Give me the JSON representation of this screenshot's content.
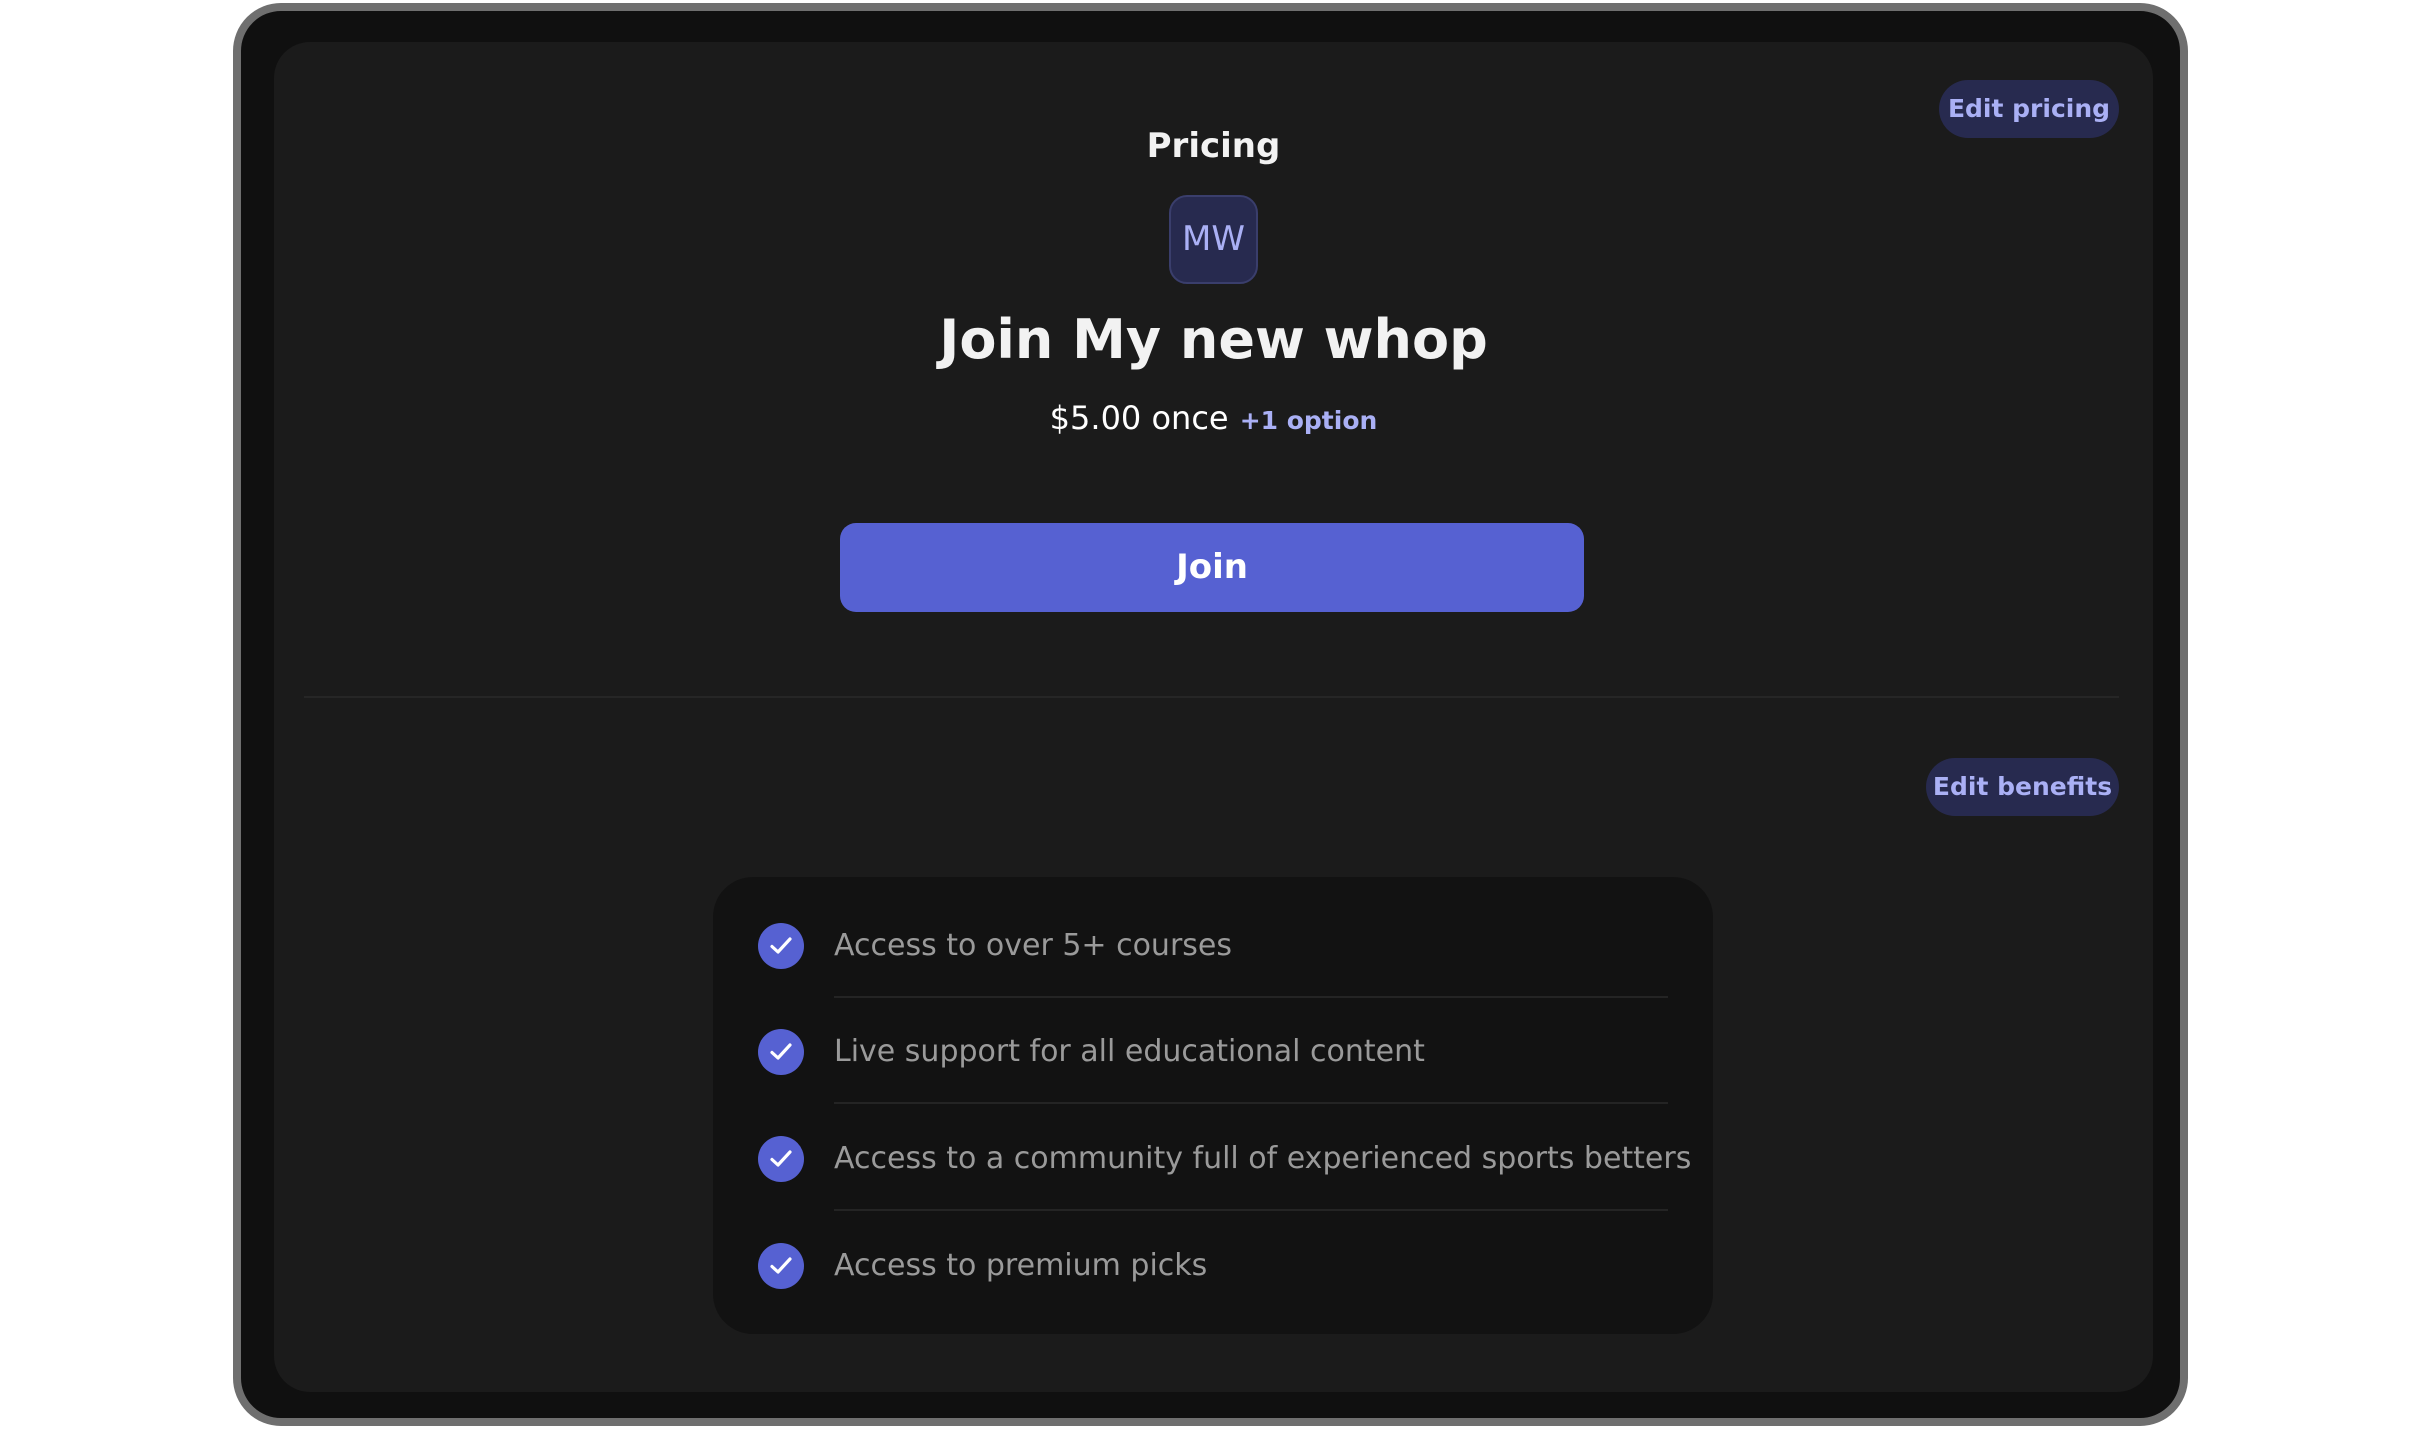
{
  "header": {
    "title": "Pricing",
    "edit_pricing_label": "Edit pricing"
  },
  "product": {
    "avatar_initials": "MW",
    "headline": "Join My new whop",
    "price": "$5.00 once",
    "extra_options": "+1 option",
    "join_label": "Join"
  },
  "benefits": {
    "edit_label": "Edit benefits",
    "items": [
      {
        "label": "Access to over 5+ courses"
      },
      {
        "label": "Live support for all educational content"
      },
      {
        "label": "Access to a community full of experienced sports betters"
      },
      {
        "label": "Access to premium picks"
      }
    ]
  },
  "icons": {
    "benefit_check": "check-icon"
  },
  "colors": {
    "accent": "#5661d2",
    "pill_bg": "#272a4f",
    "pill_text": "#aab0f5",
    "screen_bg": "#1b1b1b",
    "card_bg": "#121212"
  }
}
